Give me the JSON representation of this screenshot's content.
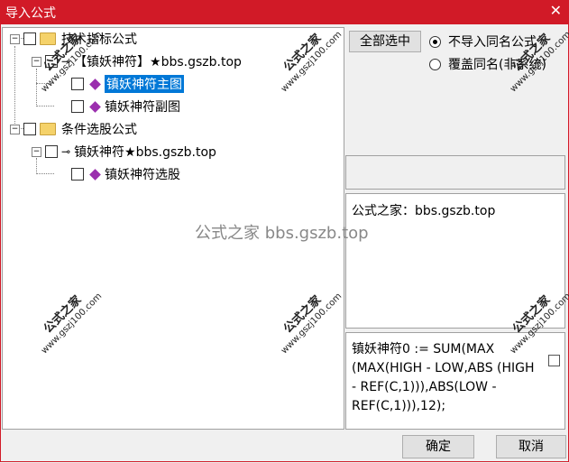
{
  "window": {
    "title": "导入公式",
    "close_glyph": "✕"
  },
  "tree": {
    "nodes": [
      {
        "level": 0,
        "expander": "−",
        "icon": "folder-icon",
        "label": "技术指标公式"
      },
      {
        "level": 1,
        "expander": "−",
        "icon": "key-icon",
        "label": "【镇妖神符】★bbs.gszb.top"
      },
      {
        "level": 2,
        "icon": "formula-icon",
        "label": "镇妖神符主图",
        "selected": true
      },
      {
        "level": 2,
        "icon": "formula-icon",
        "label": "镇妖神符副图"
      },
      {
        "level": 0,
        "expander": "−",
        "icon": "folder-icon",
        "label": "条件选股公式"
      },
      {
        "level": 1,
        "expander": "−",
        "icon": "key-icon",
        "label": "镇妖神符★bbs.gszb.top"
      },
      {
        "level": 2,
        "icon": "formula-icon",
        "label": "镇妖神符选股"
      }
    ]
  },
  "controls": {
    "select_all": "全部选中",
    "radio_skip": "不导入同名公式",
    "radio_overwrite": "覆盖同名(非系统)",
    "ok": "确定",
    "cancel": "取消"
  },
  "info": {
    "text": "公式之家：bbs.gszb.top"
  },
  "code": {
    "text": "镇妖神符0 := SUM(MAX (MAX(HIGH - LOW,ABS (HIGH - REF(C,1))),ABS(LOW - REF(C,1))),12);"
  },
  "watermark": {
    "center": "公式之家 bbs.gszb.top",
    "stamp_title": "公式之家",
    "stamp_url": "www.gszj100.com"
  }
}
